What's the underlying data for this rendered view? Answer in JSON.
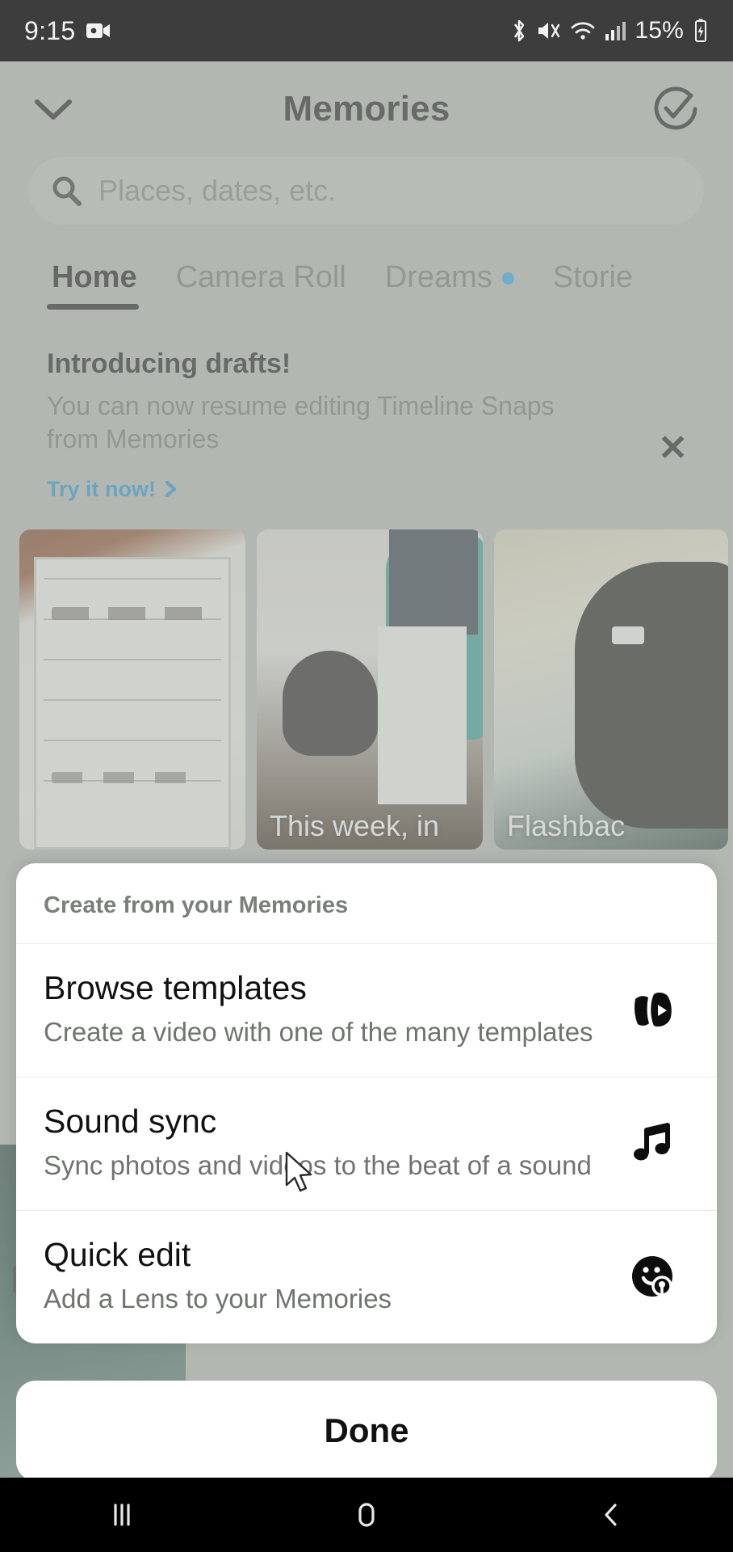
{
  "status_bar": {
    "time": "9:15",
    "battery": "15%",
    "icons": [
      "screen-recorder-icon",
      "bluetooth-icon",
      "mute-icon",
      "wifi-icon",
      "cellular-signal-icon",
      "battery-charging-icon"
    ]
  },
  "header": {
    "title": "Memories",
    "back_icon": "chevron-down-icon",
    "action_icon": "check-circle-icon"
  },
  "search": {
    "placeholder": "Places, dates, etc.",
    "icon": "search-icon"
  },
  "tabs": [
    {
      "label": "Home",
      "active": true,
      "badge": false
    },
    {
      "label": "Camera Roll",
      "active": false,
      "badge": false
    },
    {
      "label": "Dreams",
      "active": false,
      "badge": true
    },
    {
      "label": "Storie",
      "active": false,
      "badge": false
    }
  ],
  "promo": {
    "title": "Introducing drafts!",
    "body": "You can now resume editing Timeline Snaps from Memories",
    "cta": "Try it now!",
    "cta_icon": "chevron-right-icon",
    "close_icon": "close-icon"
  },
  "thumbnails": [
    {
      "caption": ""
    },
    {
      "caption": "This week, in"
    },
    {
      "caption": "Flashbac"
    }
  ],
  "sheet": {
    "header": "Create from your Memories",
    "options": [
      {
        "title": "Browse templates",
        "subtitle": "Create a video with one of the many templates",
        "icon": "templates-icon"
      },
      {
        "title": "Sound sync",
        "subtitle": "Sync photos and videos to the beat of a sound",
        "icon": "music-note-icon"
      },
      {
        "title": "Quick edit",
        "subtitle": "Add a Lens to your Memories",
        "icon": "lens-smiley-icon"
      }
    ],
    "done_label": "Done"
  },
  "nav_bar": {
    "recents": "recents-icon",
    "home": "home-icon",
    "back": "back-icon"
  },
  "colors": {
    "accent_blue": "#1a91cf",
    "badge_blue": "#1fa3e0",
    "status_bar_bg": "#3d3d3d",
    "sheet_bg": "#ffffff",
    "app_bg": "#b2b7b2"
  }
}
